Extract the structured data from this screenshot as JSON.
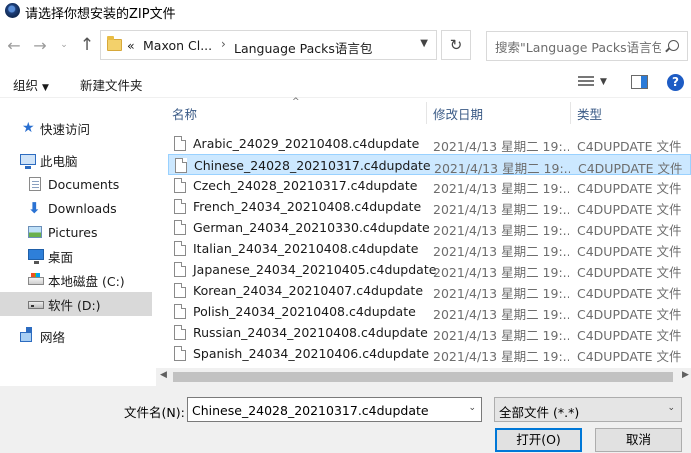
{
  "window": {
    "title": "请选择你想安装的ZIP文件"
  },
  "nav": {
    "back_glyph": "←",
    "forward_glyph": "→",
    "recent_glyph": "⌄",
    "up_glyph": "↑",
    "address_prefix": "«",
    "address_crumbs": [
      "Maxon Cl...",
      "Language Packs语言包"
    ],
    "crumb_separator": "›",
    "refresh_glyph": "↻",
    "search_placeholder": "搜索\"Language Packs语言包\""
  },
  "toolbar": {
    "organize": "组织",
    "new_folder": "新建文件夹",
    "help": "?"
  },
  "sidebar": {
    "items": [
      {
        "label": "快速访问",
        "icon": "star-icon"
      },
      {
        "label": "此电脑",
        "icon": "pc-icon"
      },
      {
        "label": "Documents",
        "icon": "documents-icon"
      },
      {
        "label": "Downloads",
        "icon": "downloads-icon"
      },
      {
        "label": "Pictures",
        "icon": "pictures-icon"
      },
      {
        "label": "桌面",
        "icon": "desktop-icon"
      },
      {
        "label": "本地磁盘 (C:)",
        "icon": "windows-drive-icon"
      },
      {
        "label": "软件 (D:)",
        "icon": "drive-icon",
        "selected": true
      },
      {
        "label": "网络",
        "icon": "network-icon"
      }
    ]
  },
  "filelist": {
    "columns": {
      "name": "名称",
      "date": "修改日期",
      "type": "类型"
    },
    "rows": [
      {
        "name": "Arabic_24029_20210408.c4dupdate",
        "date": "2021/4/13 星期二 19:...",
        "type": "C4DUPDATE 文件"
      },
      {
        "name": "Chinese_24028_20210317.c4dupdate",
        "date": "2021/4/13 星期二 19:...",
        "type": "C4DUPDATE 文件",
        "selected": true
      },
      {
        "name": "Czech_24028_20210317.c4dupdate",
        "date": "2021/4/13 星期二 19:...",
        "type": "C4DUPDATE 文件"
      },
      {
        "name": "French_24034_20210408.c4dupdate",
        "date": "2021/4/13 星期二 19:...",
        "type": "C4DUPDATE 文件"
      },
      {
        "name": "German_24034_20210330.c4dupdate",
        "date": "2021/4/13 星期二 19:...",
        "type": "C4DUPDATE 文件"
      },
      {
        "name": "Italian_24034_20210408.c4dupdate",
        "date": "2021/4/13 星期二 19:...",
        "type": "C4DUPDATE 文件"
      },
      {
        "name": "Japanese_24034_20210405.c4dupdate",
        "date": "2021/4/13 星期二 19:...",
        "type": "C4DUPDATE 文件"
      },
      {
        "name": "Korean_24034_20210407.c4dupdate",
        "date": "2021/4/13 星期二 19:...",
        "type": "C4DUPDATE 文件"
      },
      {
        "name": "Polish_24034_20210408.c4dupdate",
        "date": "2021/4/13 星期二 19:...",
        "type": "C4DUPDATE 文件"
      },
      {
        "name": "Russian_24034_20210408.c4dupdate",
        "date": "2021/4/13 星期二 19:...",
        "type": "C4DUPDATE 文件"
      },
      {
        "name": "Spanish_24034_20210406.c4dupdate",
        "date": "2021/4/13 星期二 19:...",
        "type": "C4DUPDATE 文件"
      }
    ]
  },
  "bottom": {
    "filename_label": "文件名(N):",
    "filename_value": "Chinese_24028_20210317.c4dupdate",
    "filter_value": "全部文件 (*.*)",
    "open_button": "打开(O)",
    "cancel_button": "取消"
  },
  "colors": {
    "selection_bg": "#cce8ff",
    "selection_border": "#99d1ff",
    "nav_selected_bg": "#d9d9d9",
    "default_button_border": "#0078d7",
    "column_header_text": "#3a5a86"
  }
}
